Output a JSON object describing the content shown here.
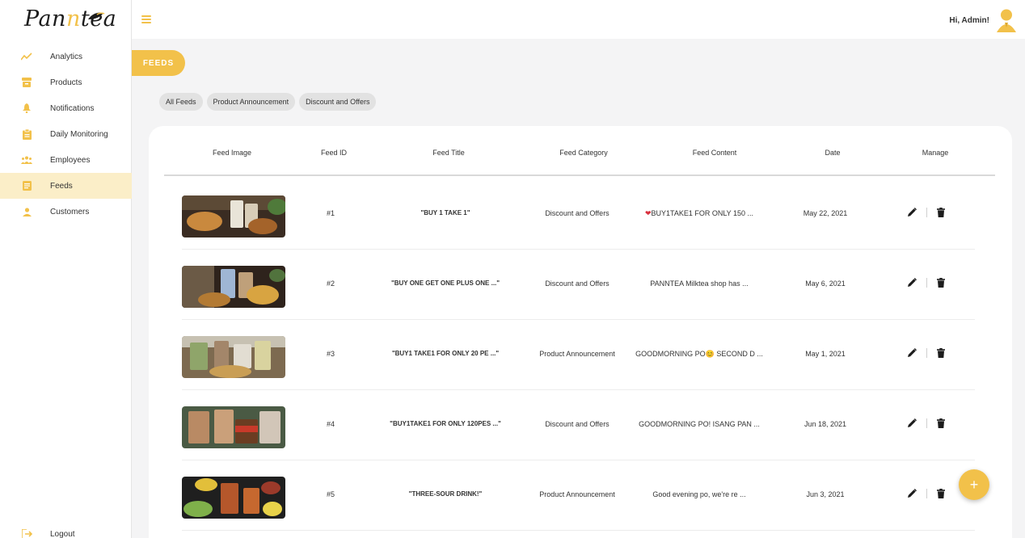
{
  "app": {
    "logo_part1": "Pan",
    "logo_part2": "n",
    "logo_part3": "tea"
  },
  "sidebar": {
    "items": [
      {
        "label": "Analytics",
        "icon": "analytics-icon",
        "active": false
      },
      {
        "label": "Products",
        "icon": "products-icon",
        "active": false
      },
      {
        "label": "Notifications",
        "icon": "bell-icon",
        "active": false
      },
      {
        "label": "Daily Monitoring",
        "icon": "clipboard-icon",
        "active": false
      },
      {
        "label": "Employees",
        "icon": "group-icon",
        "active": false
      },
      {
        "label": "Feeds",
        "icon": "feeds-icon",
        "active": true
      },
      {
        "label": "Customers",
        "icon": "person-icon",
        "active": false
      }
    ],
    "logout_label": "Logout"
  },
  "header": {
    "greeting": "Hi, Admin!"
  },
  "page": {
    "title": "FEEDS"
  },
  "filters": [
    "All Feeds",
    "Product Announcement",
    "Discount and Offers"
  ],
  "table": {
    "columns": [
      "Feed Image",
      "Feed ID",
      "Feed Title",
      "Feed Category",
      "Feed Content",
      "Date",
      "Manage"
    ],
    "rows": [
      {
        "id": "#1",
        "title": "\"BUY 1 TAKE 1\"",
        "category": "Discount and Offers",
        "content": "BUY1TAKE1 FOR ONLY 150 ...",
        "content_prefix": "❤",
        "date": "May 22, 2021"
      },
      {
        "id": "#2",
        "title": "\"BUY ONE GET ONE PLUS ONE ...\"",
        "category": "Discount and Offers",
        "content": "PANNTEA Milktea shop has ...",
        "content_prefix": "",
        "date": "May 6, 2021"
      },
      {
        "id": "#3",
        "title": "\"BUY1 TAKE1 FOR ONLY 20 PE ...\"",
        "category": "Product Announcement",
        "content": "GOODMORNING PO😊 SECOND D ...",
        "content_prefix": "",
        "date": "May 1, 2021"
      },
      {
        "id": "#4",
        "title": "\"BUY1TAKE1 FOR ONLY 120PES ...\"",
        "category": "Discount and Offers",
        "content": "GOODMORNING PO! ISANG PAN ...",
        "content_prefix": "",
        "date": "Jun 18, 2021"
      },
      {
        "id": "#5",
        "title": "\"THREE-SOUR DRINK!\"",
        "category": "Product Announcement",
        "content": "Good evening po, we're re ...",
        "content_prefix": "",
        "date": "Jun 3, 2021"
      }
    ]
  },
  "fab": {
    "label": "+"
  },
  "colors": {
    "accent": "#f2c14a",
    "active_bg": "#fbeec8",
    "heart": "#d9303e"
  }
}
